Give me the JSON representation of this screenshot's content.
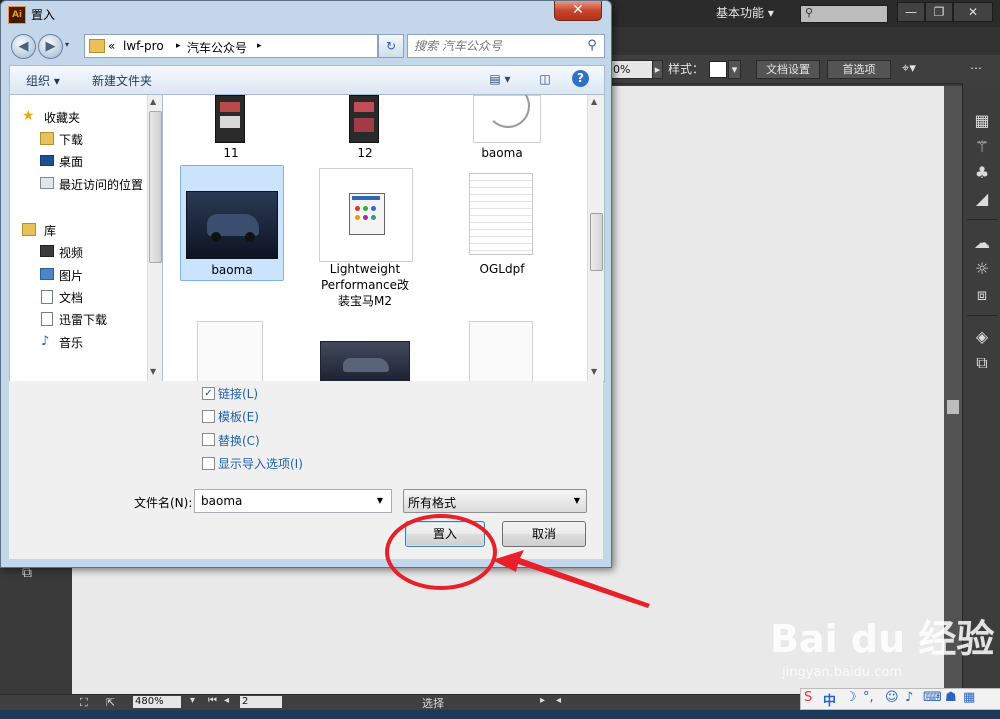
{
  "app": {
    "workspace_label": "基本功能",
    "workspace_arrow": "▾",
    "control_bar": {
      "zoom_field": "0%",
      "style_label": "样式：",
      "doc_setup_button": "文档设置",
      "preferences_button": "首选项"
    },
    "status_bar": {
      "zoom": "480%",
      "page": "2",
      "tool": "选择"
    }
  },
  "dialog": {
    "title": "置入",
    "close_glyph": "✕",
    "breadcrumb": {
      "overflow": "«",
      "parts": [
        "lwf-pro",
        "汽车公众号"
      ],
      "separator": "▸"
    },
    "search_placeholder": "搜索 汽车公众号",
    "toolbar": {
      "organize": "组织 ▾",
      "new_folder": "新建文件夹",
      "help": "?"
    },
    "nav_pane": {
      "items": [
        {
          "label": "收藏夹",
          "icon": "star-icon"
        },
        {
          "label": "下载",
          "icon": "download-folder-icon"
        },
        {
          "label": "桌面",
          "icon": "desktop-icon"
        },
        {
          "label": "最近访问的位置",
          "icon": "recent-places-icon"
        },
        {
          "label": "库",
          "icon": "library-icon"
        },
        {
          "label": "视频",
          "icon": "video-library-icon"
        },
        {
          "label": "图片",
          "icon": "pictures-library-icon"
        },
        {
          "label": "文档",
          "icon": "documents-library-icon"
        },
        {
          "label": "迅雷下载",
          "icon": "xunlei-download-icon"
        },
        {
          "label": "音乐",
          "icon": "music-library-icon"
        }
      ]
    },
    "files": [
      {
        "name": "11"
      },
      {
        "name": "12"
      },
      {
        "name": "baoma"
      },
      {
        "name": "baoma"
      },
      {
        "name_lines": [
          "Lightweight",
          "Performance改",
          "装宝马M2"
        ]
      },
      {
        "name": "OGLdpf"
      }
    ],
    "options": [
      {
        "label": "链接(L)",
        "checked": true
      },
      {
        "label": "模板(E)",
        "checked": false
      },
      {
        "label": "替换(C)",
        "checked": false
      },
      {
        "label": "显示导入选项(I)",
        "checked": false
      }
    ],
    "filename_label": "文件名(N):",
    "filename_value": "baoma",
    "filetype_value": "所有格式",
    "place_button": "置入",
    "cancel_button": "取消"
  },
  "watermark": {
    "brand": "Bai du 经验",
    "url": "jingyan.baidu.com"
  },
  "colors": {
    "annotation_red": "#e8202a",
    "dialog_frame": "#c3d6ea",
    "selection": "#cce4fb",
    "link_text": "#1f5fa9"
  }
}
